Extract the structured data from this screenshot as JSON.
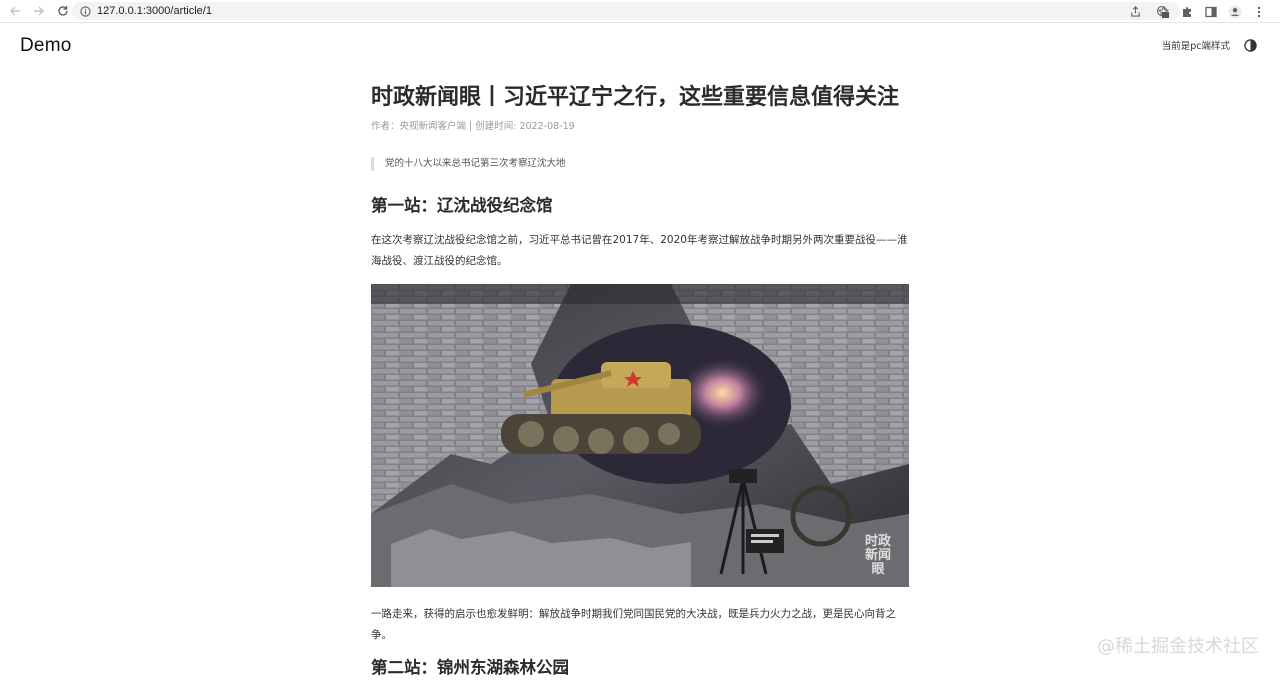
{
  "browser": {
    "url": "127.0.0.1:3000/article/1",
    "icons": [
      "back-icon",
      "forward-icon",
      "reload-icon",
      "info-icon",
      "share-icon",
      "star-icon",
      "extension-badge-icon",
      "puzzle-icon",
      "sidepanel-icon",
      "profile-icon",
      "menu-icon"
    ]
  },
  "header": {
    "logo": "Demo",
    "mode_text": "当前是pc端样式",
    "theme_icon": "theme-toggle-icon"
  },
  "article": {
    "title": "时政新闻眼丨习近平辽宁之行，这些重要信息值得关注",
    "meta": "作者：央视新闻客户端 | 创建时间: 2022-08-19",
    "quote": "党的十八大以来总书记第三次考察辽沈大地",
    "section1_heading": "第一站：辽沈战役纪念馆",
    "para1": "在这次考察辽沈战役纪念馆之前，习近平总书记曾在2017年、2020年考察过解放战争时期另外两次重要战役——淮海战役、渡江战役的纪念馆。",
    "image_watermark": "时政新闻眼",
    "para2": "一路走来，获得的启示也愈发鲜明：解放战争时期我们党同国民党的大决战，既是兵力火力之战，更是民心向背之争。",
    "section2_heading": "第二站：锦州东湖森林公园"
  },
  "watermark": "@稀土掘金技术社区"
}
